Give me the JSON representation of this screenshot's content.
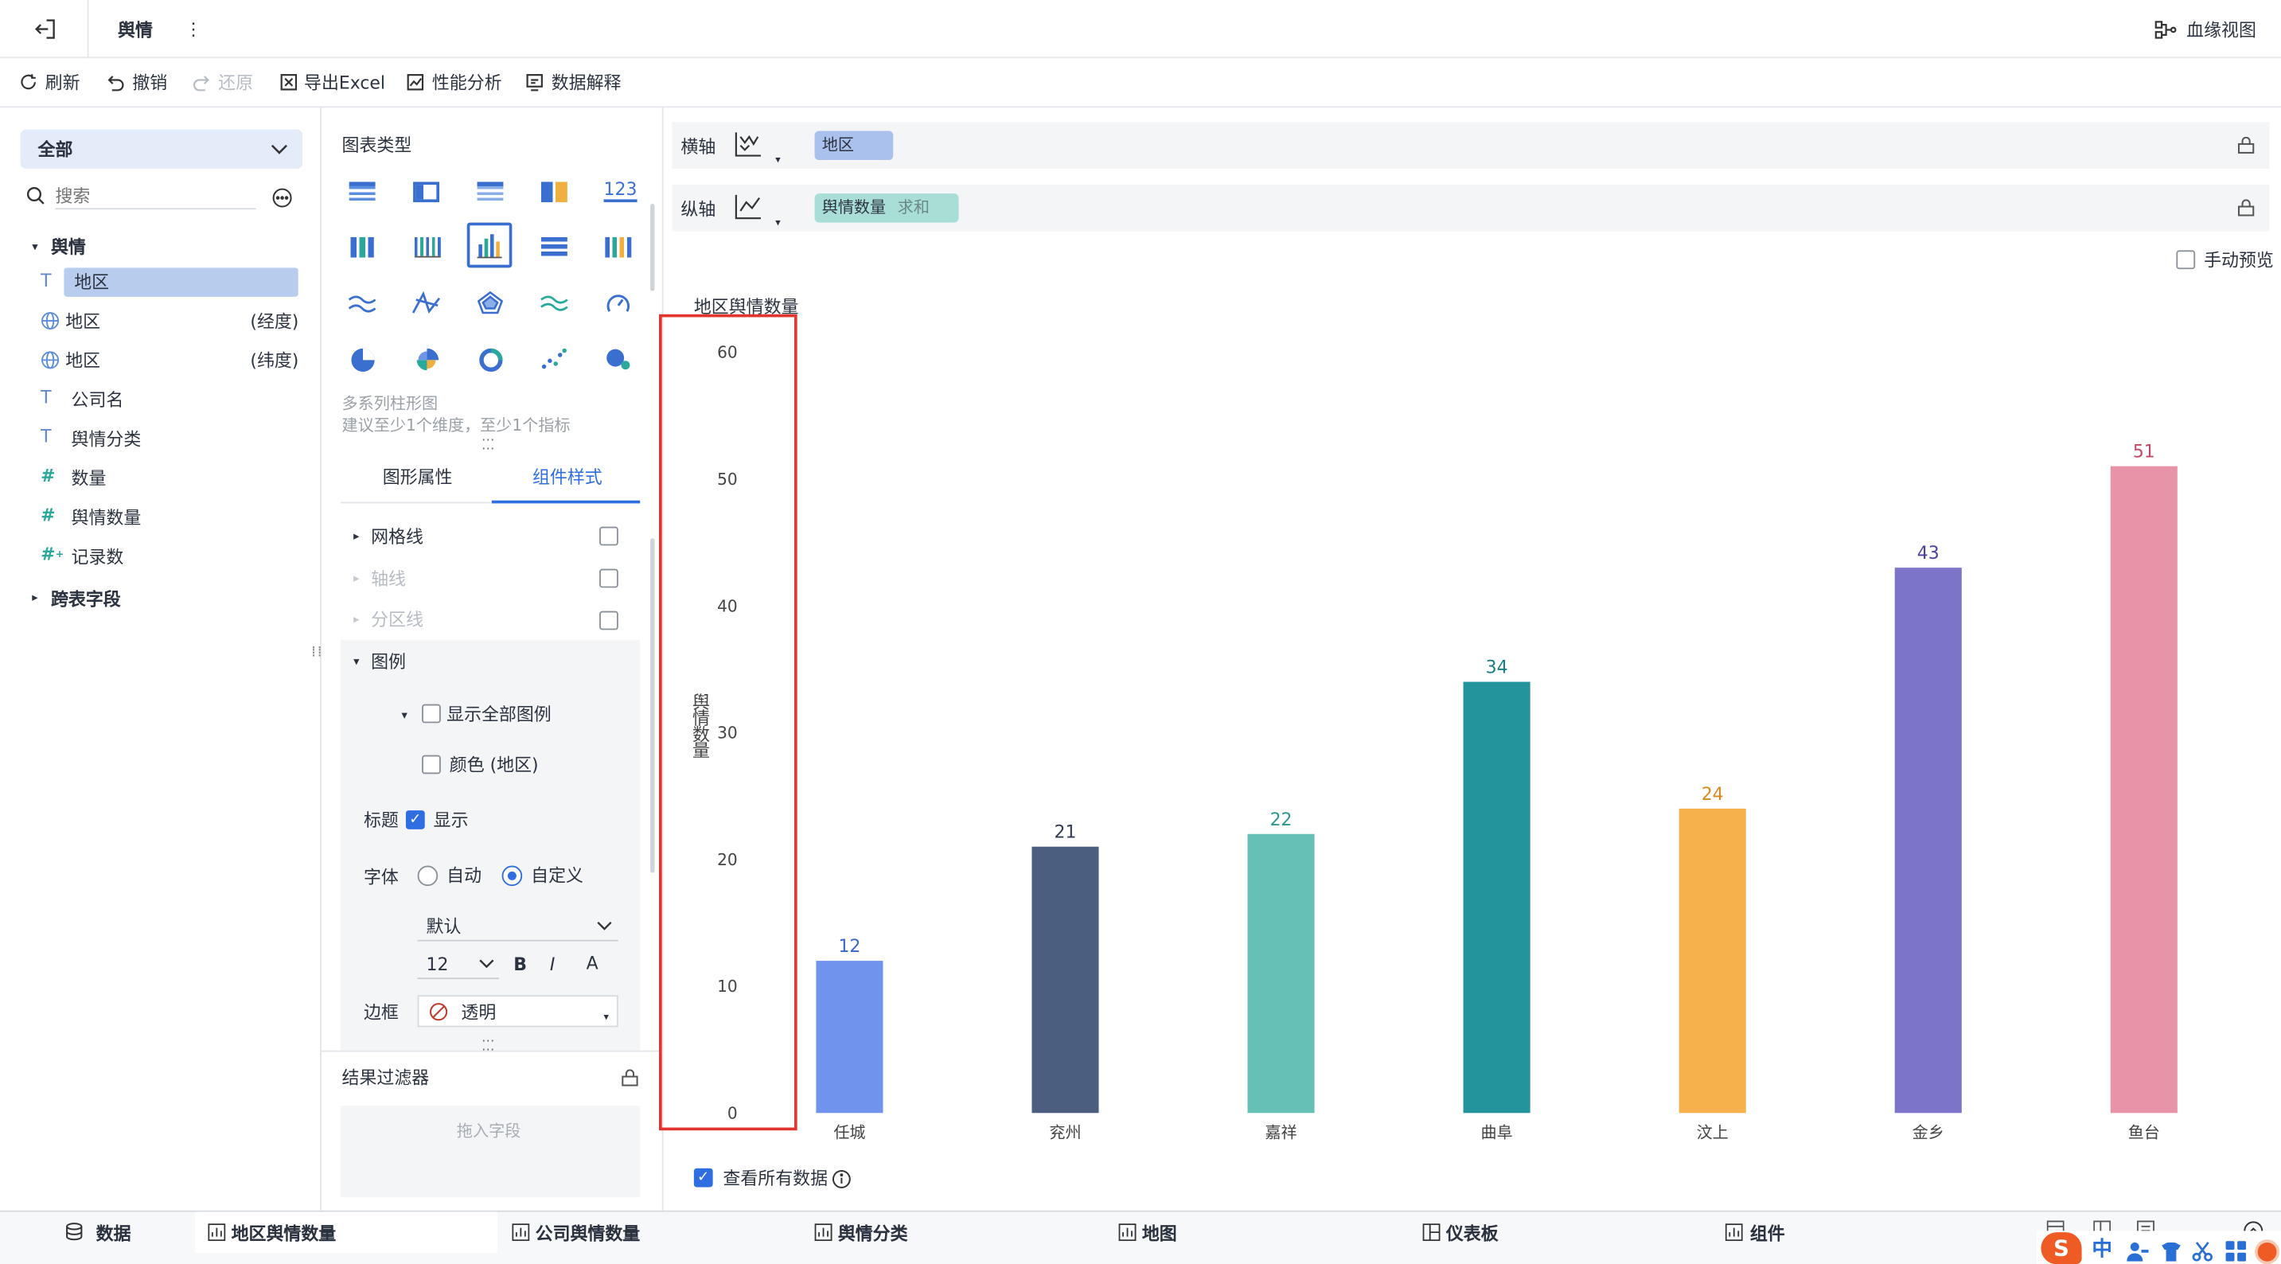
{
  "window": {
    "title": "舆情",
    "more": "⋮",
    "lineage_label": "血缘视图"
  },
  "toolbar": {
    "refresh": "刷新",
    "undo": "撤销",
    "redo": "还原",
    "export_excel": "导出Excel",
    "perf": "性能分析",
    "explain": "数据解释"
  },
  "fields_panel": {
    "scope_select": "全部",
    "search_placeholder": "搜索",
    "group": "舆情",
    "items": [
      {
        "name": "地区",
        "suffix": "",
        "type": "text",
        "selected": true
      },
      {
        "name": "地区",
        "suffix": "(经度)",
        "type": "geo"
      },
      {
        "name": "地区",
        "suffix": "(纬度)",
        "type": "geo"
      },
      {
        "name": "公司名",
        "suffix": "",
        "type": "text"
      },
      {
        "name": "舆情分类",
        "suffix": "",
        "type": "text"
      },
      {
        "name": "数量",
        "suffix": "",
        "type": "number"
      },
      {
        "name": "舆情数量",
        "suffix": "",
        "type": "number"
      },
      {
        "name": "记录数",
        "suffix": "",
        "type": "number-count"
      }
    ],
    "cross_table": "跨表字段"
  },
  "chart_type_panel": {
    "title": "图表类型",
    "selected_name": "多系列柱形图",
    "hint": "建议至少1个维度，至少1个指标",
    "tabs": [
      "图形属性",
      "组件样式"
    ],
    "active_tab": 1
  },
  "style_panel": {
    "gridlines": "网格线",
    "axis": "轴线",
    "zone": "分区线",
    "legend": "图例",
    "show_all_legend": "显示全部图例",
    "color_legend": "颜色 (地区)",
    "title_label": "标题",
    "title_show": "显示",
    "font_label": "字体",
    "font_auto": "自动",
    "font_custom": "自定义",
    "font_family": "默认",
    "font_size": "12",
    "bold": "B",
    "italic": "I",
    "color": "A",
    "border_label": "边框",
    "border_value": "透明"
  },
  "filter_panel": {
    "title": "结果过滤器",
    "drop_hint": "拖入字段"
  },
  "axes_config": {
    "x_label": "横轴",
    "x_field": "地区",
    "y_label": "纵轴",
    "y_field": "舆情数量",
    "y_agg": "求和"
  },
  "manual_preview": "手动预览",
  "view_all": "查看所有数据",
  "chart_data": {
    "type": "bar",
    "title": "地区舆情数量",
    "ylabel": "舆情数量",
    "categories": [
      "任城",
      "兖州",
      "嘉祥",
      "曲阜",
      "汶上",
      "金乡",
      "鱼台"
    ],
    "values": [
      12,
      21,
      22,
      34,
      24,
      43,
      51
    ],
    "colors": [
      "#7094ee",
      "#4b5e80",
      "#66c0b6",
      "#24949c",
      "#f6b04c",
      "#7b74c9",
      "#e694a6"
    ],
    "label_colors": [
      "#3b66cc",
      "#333d52",
      "#2a9a8e",
      "#1a7c84",
      "#d98a1c",
      "#4a429a",
      "#c04a66"
    ],
    "yticks": [
      0,
      10,
      20,
      30,
      40,
      50,
      60
    ],
    "ylim": [
      0,
      60
    ],
    "grid": false,
    "legend": "none"
  },
  "bottom_tabs": [
    {
      "label": "数据",
      "active": false
    },
    {
      "label": "地区舆情数量",
      "active": true
    },
    {
      "label": "公司舆情数量",
      "active": false
    },
    {
      "label": "舆情分类",
      "active": false
    },
    {
      "label": "地图",
      "active": false
    },
    {
      "label": "仪表板",
      "active": false
    },
    {
      "label": "组件",
      "active": false
    }
  ],
  "ime": {
    "lang": "中"
  }
}
